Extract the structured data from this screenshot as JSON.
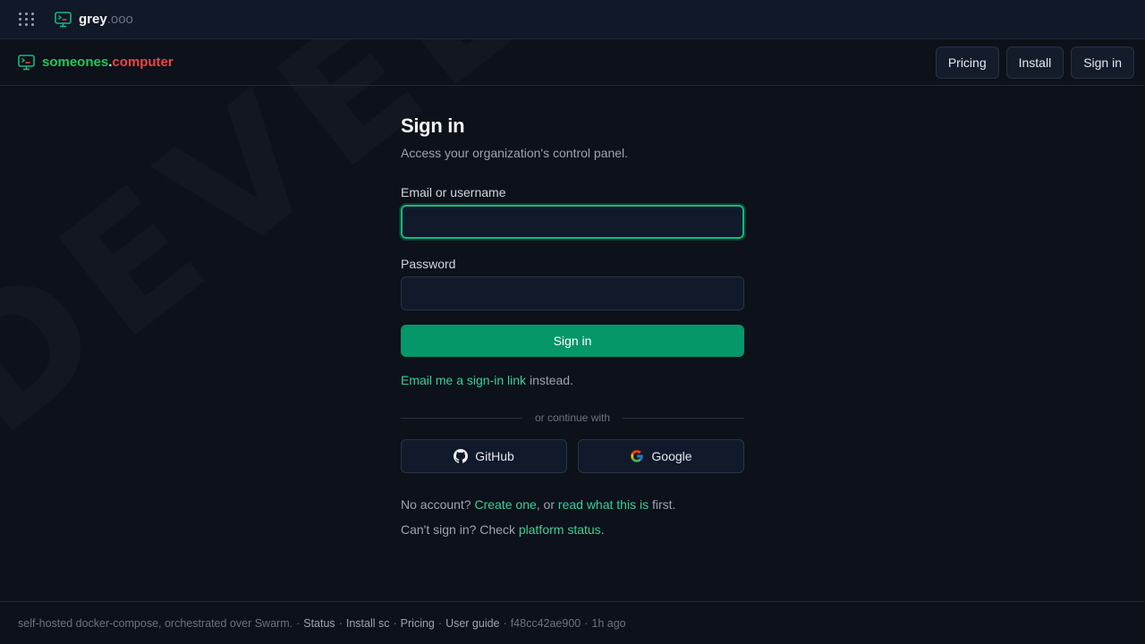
{
  "watermark": "DEVELOPMENT",
  "topbar": {
    "app_name": "grey",
    "app_tld": ".ooo"
  },
  "navbar": {
    "brand_part1": "someones",
    "brand_dot": ".",
    "brand_part2": "computer",
    "pricing": "Pricing",
    "install": "Install",
    "signin": "Sign in"
  },
  "form": {
    "title": "Sign in",
    "subtitle": "Access your organization's control panel.",
    "email_label": "Email or username",
    "email_value": "",
    "password_label": "Password",
    "password_value": "",
    "submit": "Sign in",
    "magic_link": "Email me a sign-in link",
    "magic_suffix": " instead.",
    "divider": "or continue with",
    "github": "GitHub",
    "google": "Google",
    "no_account_prefix": "No account? ",
    "create_link": "Create one",
    "mid_text": ", or ",
    "read_link": "read what this is",
    "first_suffix": " first.",
    "cant_prefix": "Can't sign in? Check ",
    "status_link": "platform status",
    "period": "."
  },
  "footer": {
    "text": "self-hosted docker-compose, orchestrated over Swarm.",
    "status": "Status",
    "install": "Install sc",
    "pricing": "Pricing",
    "guide": "User guide",
    "commit": "f48cc42ae900",
    "age": "1h ago",
    "sep": "·"
  },
  "colors": {
    "accent": "#10b981",
    "brand_green": "#22c55e",
    "brand_red": "#ef4444",
    "background": "#0d1119"
  }
}
